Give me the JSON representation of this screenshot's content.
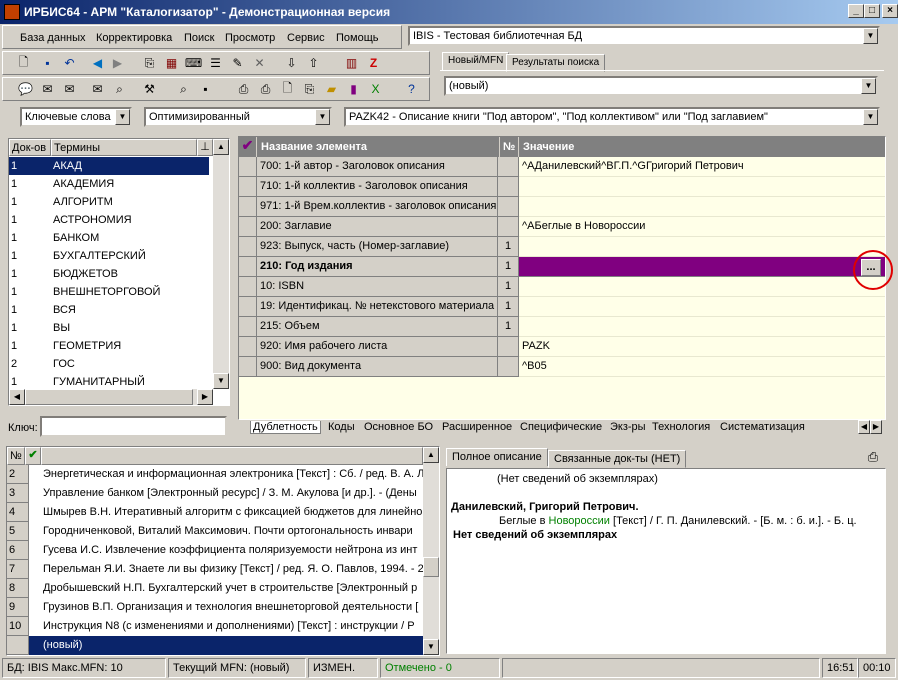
{
  "window": {
    "title": "ИРБИС64 - АРМ \"Каталогизатор\" - Демонстрационная версия",
    "controls": [
      "_",
      "□",
      "×"
    ]
  },
  "menu": [
    "База данных",
    "Корректировка",
    "Поиск",
    "Просмотр",
    "Сервис",
    "Помощь"
  ],
  "db_combo": {
    "value": "IBIS - Тестовая библиотечная БД"
  },
  "record_tabs": [
    "Новый/MFN",
    "Результаты поиска"
  ],
  "record_combo": {
    "value": "(новый)"
  },
  "search_combos": {
    "mode": "Ключевые слова",
    "strategy": "Оптимизированный",
    "worksheet": "PAZK42 - Описание книги \"Под автором\", \"Под коллективом\" или \"Под заглавием\""
  },
  "terms": {
    "headers": [
      "Док-ов",
      "Термины"
    ],
    "rows": [
      {
        "count": "1",
        "term": "АКАД"
      },
      {
        "count": "1",
        "term": "АКАДЕМИЯ"
      },
      {
        "count": "1",
        "term": "АЛГОРИТМ"
      },
      {
        "count": "1",
        "term": "АСТРОНОМИЯ"
      },
      {
        "count": "1",
        "term": "БАНКОМ"
      },
      {
        "count": "1",
        "term": "БУХГАЛТЕРСКИЙ"
      },
      {
        "count": "1",
        "term": "БЮДЖЕТОВ"
      },
      {
        "count": "1",
        "term": "ВНЕШНЕТОРГОВОЙ"
      },
      {
        "count": "1",
        "term": "ВСЯ"
      },
      {
        "count": "1",
        "term": "ВЫ"
      },
      {
        "count": "1",
        "term": "ГЕОМЕТРИЯ"
      },
      {
        "count": "2",
        "term": "ГОС"
      },
      {
        "count": "1",
        "term": "ГУМАНИТАРНЫЙ"
      }
    ],
    "key_label": "Ключ:",
    "key_value": ""
  },
  "editor": {
    "headers": [
      "Название элемента",
      "№",
      "Значение"
    ],
    "rows": [
      {
        "name": "700: 1-й  автор - Заголовок описания",
        "num": "",
        "value": "^AДанилевский^BГ.П.^GГригорий Петрович"
      },
      {
        "name": "710: 1-й коллектив - Заголовок описания",
        "num": "",
        "value": ""
      },
      {
        "name": "971: 1-й Врем.коллектив - заголовок описания",
        "num": "",
        "value": ""
      },
      {
        "name": "200: Заглавие",
        "num": "",
        "value": "^AБеглые в Новороссии"
      },
      {
        "name": "923: Выпуск, часть (Номер-заглавие)",
        "num": "1",
        "value": ""
      },
      {
        "name": "210: Год издания",
        "num": "1",
        "value": ""
      },
      {
        "name": "10: ISBN",
        "num": "1",
        "value": ""
      },
      {
        "name": "19: Идентификац. № нетекстового материала",
        "num": "1",
        "value": ""
      },
      {
        "name": "215: Объем",
        "num": "1",
        "value": ""
      },
      {
        "name": "920: Имя рабочего листа",
        "num": "",
        "value": "PAZK"
      },
      {
        "name": "900: Вид документа",
        "num": "",
        "value": "^B05"
      }
    ],
    "ellipsis": "...",
    "tabs": [
      "Дублетность",
      "Коды",
      "Основное БО",
      "Расширенное",
      "Специфические",
      "Экз-ры",
      "Технология",
      "Систематизация"
    ]
  },
  "doclist": {
    "header_num": "№",
    "rows": [
      {
        "n": "2",
        "text": "Энергетическая и информационная электроника [Текст] : Сб. / ред. В. А. Л"
      },
      {
        "n": "3",
        "text": "Управление банком [Электронный ресурс]  / З. М. Акулова [и др.]. - (Дены"
      },
      {
        "n": "4",
        "text": "Шмырев В.Н. Итеративный алгоритм с фиксацией бюджетов для линейно"
      },
      {
        "n": "5",
        "text": "Городниченковой, Виталий Максимович. Почти ортогональность инвари"
      },
      {
        "n": "6",
        "text": "Гусева И.С. Извлечение коэффициента поляризуемости нейтрона из инт"
      },
      {
        "n": "7",
        "text": "Перельман Я.И. Знаете ли вы физику [Текст] / ред. Я. О. Павлов, 1994. - 2"
      },
      {
        "n": "8",
        "text": "Дробышевский Н.П. Бухгалтерский учет в строительстве [Электронный р"
      },
      {
        "n": "9",
        "text": "Грузинов В.П. Организация и технология внешнеторговой деятельности ["
      },
      {
        "n": "10",
        "text": "Инструкция N8   (с изменениями и дополнениями) [Текст] : инструкции / Р"
      },
      {
        "n": "",
        "text": "(новый)"
      }
    ]
  },
  "preview": {
    "tabs": [
      "Полное описание",
      "Связанные док-ты (НЕТ)"
    ],
    "line1": "(Нет сведений об экземплярах)",
    "author": "Данилевский, Григорий Петрович.",
    "desc_pre": "Беглые в ",
    "desc_link": "Новороссии",
    "desc_post": " [Текст] / Г. П. Данилевский. - [Б. м. : б. и.]. - Б. ц.",
    "no_items": "Нет сведений об экземплярах"
  },
  "status": {
    "db": "БД: IBIS Макс.MFN: 10",
    "current": "Текущий MFN: (новый)",
    "changed": "ИЗМЕН.",
    "marked": "Отмечено - 0",
    "time": "16:51",
    "counter": "00:10"
  },
  "colors": {
    "accent_selected": "#800080",
    "field_bg": "#ffffe8",
    "selected_row": "#0a246a",
    "status_green": "#008000",
    "link_green": "#008000"
  }
}
